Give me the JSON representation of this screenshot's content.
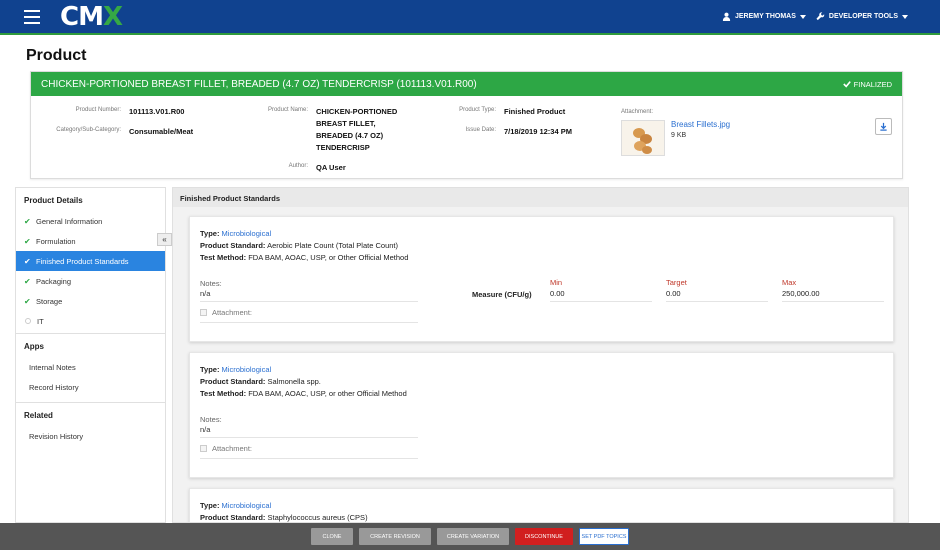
{
  "topbar": {
    "logo_left": "CM",
    "logo_x": "X",
    "user_name": "JEREMY THOMAS",
    "dev_tools": "DEVELOPER TOOLS"
  },
  "page": {
    "title": "Product"
  },
  "header": {
    "title": "CHICKEN-PORTIONED BREAST FILLET, BREADED (4.7 OZ) TENDERCRISP (101113.V01.R00)",
    "status": "FINALIZED",
    "product_number_label": "Product Number:",
    "product_number": "101113.V01.R00",
    "category_label": "Category/Sub-Category:",
    "category": "Consumable/Meat",
    "product_name_label": "Product Name:",
    "product_name_lines": [
      "CHICKEN-PORTIONED",
      "BREAST FILLET,",
      "BREADED (4.7 OZ)",
      "TENDERCRISP"
    ],
    "author_label": "Author:",
    "author": "QA User",
    "product_type_label": "Product Type:",
    "product_type": "Finished Product",
    "issue_date_label": "Issue Date:",
    "issue_date": "7/18/2019 12:34 PM",
    "attachment_label": "Attachment:",
    "attachment_name": "Breast Fillets.jpg",
    "attachment_size": "9 KB"
  },
  "sidebar": {
    "product_details_title": "Product Details",
    "items": [
      {
        "label": "General Information",
        "status": "check"
      },
      {
        "label": "Formulation",
        "status": "check"
      },
      {
        "label": "Finished Product Standards",
        "status": "check",
        "active": true
      },
      {
        "label": "Packaging",
        "status": "check"
      },
      {
        "label": "Storage",
        "status": "check"
      },
      {
        "label": "IT",
        "status": "empty"
      }
    ],
    "apps_title": "Apps",
    "apps": [
      "Internal Notes",
      "Record History"
    ],
    "related_title": "Related",
    "related": [
      "Revision History"
    ],
    "collapse_glyph": "«"
  },
  "main": {
    "section_title": "Finished Product Standards",
    "labels": {
      "type": "Type:",
      "product_standard": "Product Standard:",
      "test_method": "Test Method:",
      "notes": "Notes:",
      "attachment": "Attachment:",
      "measure": "Measure (CFU/g)",
      "min": "Min",
      "target": "Target",
      "max": "Max"
    },
    "standards": [
      {
        "type": "Microbiological",
        "product_standard": "Aerobic Plate Count (Total Plate Count)",
        "test_method": "FDA BAM, AOAC, USP, or Other Official Method",
        "notes": "n/a",
        "min": "0.00",
        "target": "0.00",
        "max": "250,000.00"
      },
      {
        "type": "Microbiological",
        "product_standard": "Salmonella spp.",
        "test_method": "FDA BAM, AOAC, USP, or other Official Method",
        "notes": "n/a"
      },
      {
        "type": "Microbiological",
        "product_standard": "Staphylococcus aureus (CPS)"
      }
    ]
  },
  "footer": {
    "clone": "CLONE",
    "create_revision": "CREATE REVISION",
    "create_variation": "CREATE VARIATION",
    "discontinue": "DISCONTINUE",
    "set_pdf_topics": "SET PDF TOPICS"
  },
  "colors": {
    "topbar": "#10428f",
    "green": "#2da745",
    "active_blue": "#2a84e0",
    "discontinue_red": "#d11f1f"
  }
}
